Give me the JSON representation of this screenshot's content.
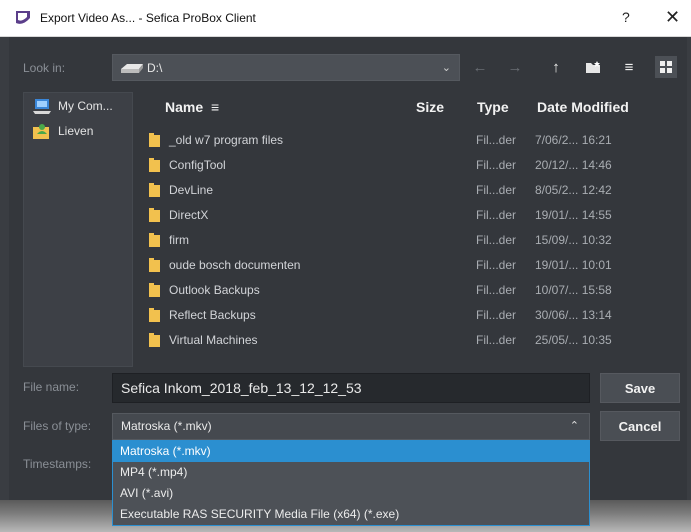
{
  "window": {
    "title": "Export Video As... - Sefica ProBox Client",
    "help_glyph": "?",
    "close_glyph": "✕"
  },
  "toolbar": {
    "lookin_label": "Look in:",
    "lookin_value": "D:\\",
    "dropdown_glyph": "⌄",
    "back_glyph": "←",
    "forward_glyph": "→",
    "up_glyph": "↑",
    "list_view_glyph": "≡"
  },
  "sidebar": {
    "items": [
      {
        "label": "My Com...",
        "icon": "computer-icon"
      },
      {
        "label": "Lieven",
        "icon": "user-folder-icon"
      }
    ]
  },
  "columns": {
    "name": "Name",
    "sort_glyph": "≡",
    "size": "Size",
    "type": "Type",
    "date": "Date Modified"
  },
  "files": [
    {
      "name": "_old w7 program files",
      "type": "Fil...der",
      "date": "7/06/2... 16:21"
    },
    {
      "name": "ConfigTool",
      "type": "Fil...der",
      "date": "20/12/... 14:46"
    },
    {
      "name": "DevLine",
      "type": "Fil...der",
      "date": "8/05/2... 12:42"
    },
    {
      "name": "DirectX",
      "type": "Fil...der",
      "date": "19/01/... 14:55"
    },
    {
      "name": "firm",
      "type": "Fil...der",
      "date": "15/09/... 10:32"
    },
    {
      "name": "oude bosch documenten",
      "type": "Fil...der",
      "date": "19/01/... 10:01"
    },
    {
      "name": "Outlook Backups",
      "type": "Fil...der",
      "date": "10/07/... 15:58"
    },
    {
      "name": "Reflect Backups",
      "type": "Fil...der",
      "date": "30/06/... 13:14"
    },
    {
      "name": "Virtual Machines",
      "type": "Fil...der",
      "date": "25/05/... 10:35"
    }
  ],
  "form": {
    "filename_label": "File name:",
    "filename_value": "Sefica Inkom_2018_feb_13_12_12_53",
    "filetype_label": "Files of type:",
    "filetype_value": "Matroska (*.mkv)",
    "filetype_arrow": "⌃",
    "timestamps_label": "Timestamps:",
    "save_label": "Save",
    "cancel_label": "Cancel"
  },
  "dropdown_options": [
    "Matroska (*.mkv)",
    "MP4 (*.mp4)",
    "AVI (*.avi)",
    "Executable RAS SECURITY Media File (x64) (*.exe)"
  ],
  "colors": {
    "accent": "#2b8fd0",
    "folder": "#f2c14e",
    "dialog_bg": "#34373c"
  }
}
